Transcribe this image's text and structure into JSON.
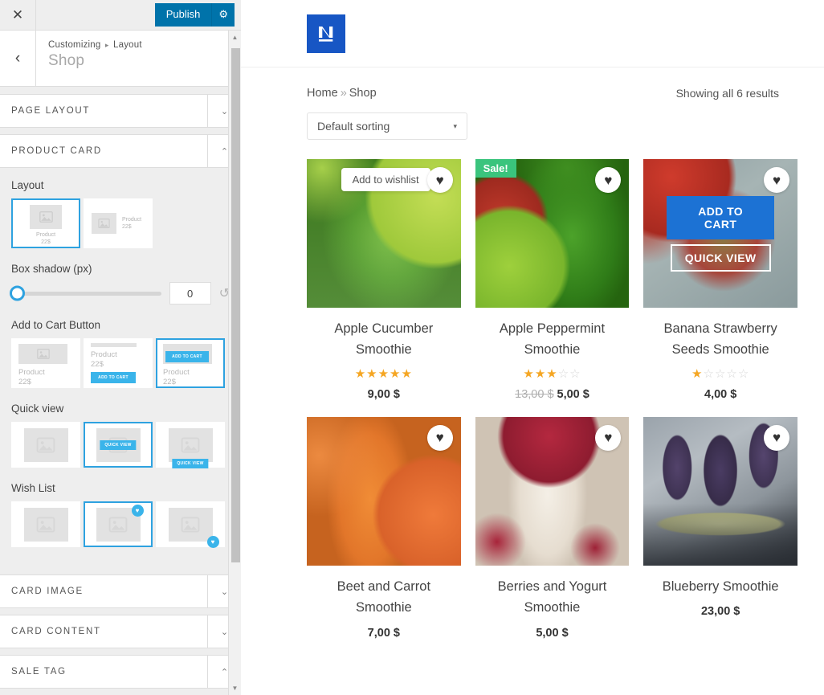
{
  "customizer": {
    "close_label": "✕",
    "publish_label": "Publish",
    "gear_icon": "⚙",
    "back_icon": "‹",
    "breadcrumb_root": "Customizing",
    "breadcrumb_sep": "▸",
    "breadcrumb_current": "Layout",
    "panel_title": "Shop",
    "sections": [
      {
        "title": "PAGE LAYOUT",
        "arrow": "⌄",
        "expanded": false
      },
      {
        "title": "PRODUCT CARD",
        "arrow": "⌃",
        "expanded": true
      },
      {
        "title": "CARD IMAGE",
        "arrow": "⌄",
        "expanded": false
      },
      {
        "title": "CARD CONTENT",
        "arrow": "⌄",
        "expanded": false
      },
      {
        "title": "SALE TAG",
        "arrow": "⌃",
        "expanded": false
      }
    ],
    "controls": {
      "layout": {
        "label": "Layout",
        "options": [
          {
            "name": "Product",
            "price": "22$",
            "selected": true
          },
          {
            "name": "Product",
            "price": "22$",
            "selected": false
          }
        ]
      },
      "box_shadow": {
        "label": "Box shadow (px)",
        "value": "0",
        "reset_icon": "↺"
      },
      "add_to_cart": {
        "label": "Add to Cart Button",
        "button_text": "ADD TO CART",
        "options": [
          {
            "name": "Product",
            "price": "22$",
            "selected": false
          },
          {
            "name": "Product",
            "price": "22$",
            "selected": false
          },
          {
            "name": "Product",
            "price": "22$",
            "selected": true
          }
        ]
      },
      "quick_view": {
        "label": "Quick view",
        "button_text": "QUICK VIEW",
        "options": [
          {
            "selected": false
          },
          {
            "selected": true
          },
          {
            "selected": false
          }
        ]
      },
      "wish_list": {
        "label": "Wish List",
        "heart_icon": "♥",
        "options": [
          {
            "selected": false
          },
          {
            "selected": true
          },
          {
            "selected": false
          }
        ]
      }
    },
    "scrollbar": {
      "up_icon": "▲",
      "down_icon": "▼"
    }
  },
  "preview": {
    "logo_letter": "N",
    "breadcrumb": {
      "home": "Home",
      "sep": "»",
      "current": "Shop"
    },
    "results_count": "Showing all 6 results",
    "sorting": {
      "value": "Default sorting",
      "caret": "▾"
    },
    "hover_actions": {
      "add_to_cart": "ADD TO CART",
      "quick_view": "QUICK VIEW"
    },
    "wishlist_tooltip": "Add to wishlist",
    "heart_icon": "♥",
    "sale_label": "Sale!",
    "star_on": "★",
    "star_off": "☆",
    "products": [
      {
        "title": "Apple Cucumber Smoothie",
        "price": "9,00 $",
        "old_price": "",
        "rating": 5,
        "stars_total": 5,
        "sale": false,
        "tooltip": true,
        "hover": false,
        "img_class": "img-apple-cucumber"
      },
      {
        "title": "Apple Peppermint Smoothie",
        "price": "5,00 $",
        "old_price": "13,00 $",
        "rating": 3,
        "stars_total": 5,
        "sale": true,
        "tooltip": false,
        "hover": false,
        "img_class": "img-apple-peppermint"
      },
      {
        "title": "Banana Strawberry Seeds Smoothie",
        "price": "4,00 $",
        "old_price": "",
        "rating": 1,
        "stars_total": 5,
        "sale": false,
        "tooltip": false,
        "hover": true,
        "img_class": "img-banana-strawberry"
      },
      {
        "title": "Beet and Carrot Smoothie",
        "price": "7,00 $",
        "old_price": "",
        "rating": 0,
        "stars_total": 0,
        "sale": false,
        "tooltip": false,
        "hover": false,
        "img_class": "img-beet-carrot"
      },
      {
        "title": "Berries and Yogurt Smoothie",
        "price": "5,00 $",
        "old_price": "",
        "rating": 0,
        "stars_total": 0,
        "sale": false,
        "tooltip": false,
        "hover": false,
        "img_class": "img-berries-yogurt"
      },
      {
        "title": "Blueberry Smoothie",
        "price": "23,00 $",
        "old_price": "",
        "rating": 0,
        "stars_total": 0,
        "sale": false,
        "tooltip": false,
        "hover": false,
        "img_class": "img-blueberry"
      }
    ]
  },
  "colors": {
    "wp_blue": "#0073aa",
    "accent_blue": "#2ea2e0",
    "badge_blue": "#3ab4ea",
    "sale_green": "#3ac47d",
    "cart_blue": "#1c72d4",
    "star_gold": "#f5a623",
    "logo_blue": "#1756c4"
  }
}
